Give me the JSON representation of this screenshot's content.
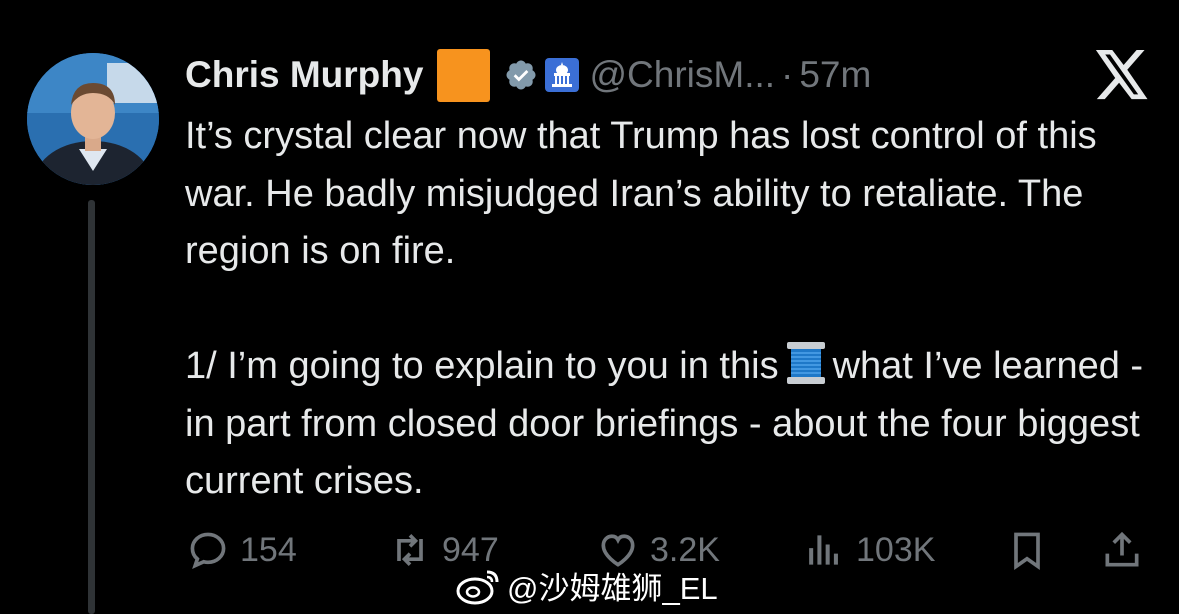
{
  "author": {
    "name": "Chris Murphy",
    "flag_icon": "orange-square-emoji",
    "verified_icon": "verified-badge-icon",
    "affiliation_icon": "capitol-building-icon",
    "handle": "@ChrisM...",
    "separator": "·",
    "time": "57m"
  },
  "platform_logo": "x-logo-icon",
  "tweet": {
    "paragraph1": "It’s crystal clear now that Trump has lost control of this war. He badly misjudged Iran’s ability to retaliate. The region is on fire.",
    "paragraph2_before_emoji": "1/ I’m going to explain to you in this",
    "thread_emoji": "spool-of-thread-emoji",
    "paragraph2_after_emoji": "what I’ve learned - in part from closed door briefings - about the four biggest current crises."
  },
  "actions": {
    "replies": "154",
    "reposts": "947",
    "likes": "3.2K",
    "views": "103K"
  },
  "watermark": "@沙姆雄狮_EL",
  "colors": {
    "background": "#000000",
    "text": "#e7e9ea",
    "muted": "#71767b",
    "verified": "#829aab"
  }
}
